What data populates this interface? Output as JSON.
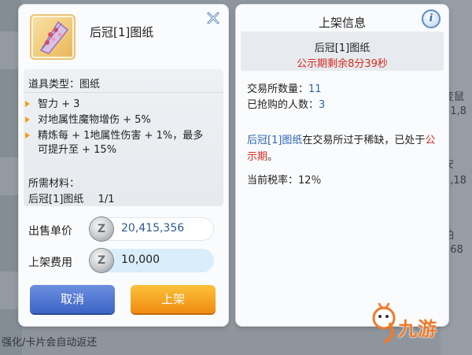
{
  "background": {
    "right_texts": [
      "变鼠",
      "41,8",
      "安",
      "1,18",
      "铂",
      "368"
    ],
    "bottom_text": "强化/卡片会自动返还"
  },
  "listing_dialog": {
    "item_name": "后冠[1]图纸",
    "close_icon": "close-x-icon",
    "item_type": "道具类型：图纸",
    "stats": [
      "智力 + 3",
      "对地属性魔物增伤 + 5%",
      "精炼每 + 1地属性伤害 + 1%，最多可提升至 + 15%"
    ],
    "materials_title": "所需材料：",
    "materials_item": "后冠[1]图纸",
    "materials_count": "1/1",
    "unit_price_label": "出售单价",
    "unit_price_value": "20,415,356",
    "listing_fee_label": "上架费用",
    "listing_fee_value": "10,000",
    "coin_glyph": "Z",
    "cancel_label": "取消",
    "list_label": "上架"
  },
  "listing_info": {
    "title": "上架信息",
    "info_icon": "i",
    "item_name": "后冠[1]图纸",
    "countdown": "公示期剩余8分39秒",
    "trade_count_label": "交易所数量：",
    "trade_count_value": "11",
    "grabbed_label": "已抢购的人数：",
    "grabbed_value": "3",
    "scarcity_item": "后冠[1]图纸",
    "scarcity_text": "在交易所过于稀缺，已处于",
    "scarcity_period": "公示期",
    "scarcity_end": "。",
    "tax_label": "当前税率：",
    "tax_value": "12％"
  },
  "watermark": {
    "text": "九游"
  },
  "colors": {
    "accent_blue": "#2b66b3",
    "alert_red": "#d8281c",
    "cancel_button": "#3c64c6",
    "list_button": "#f08b12"
  }
}
